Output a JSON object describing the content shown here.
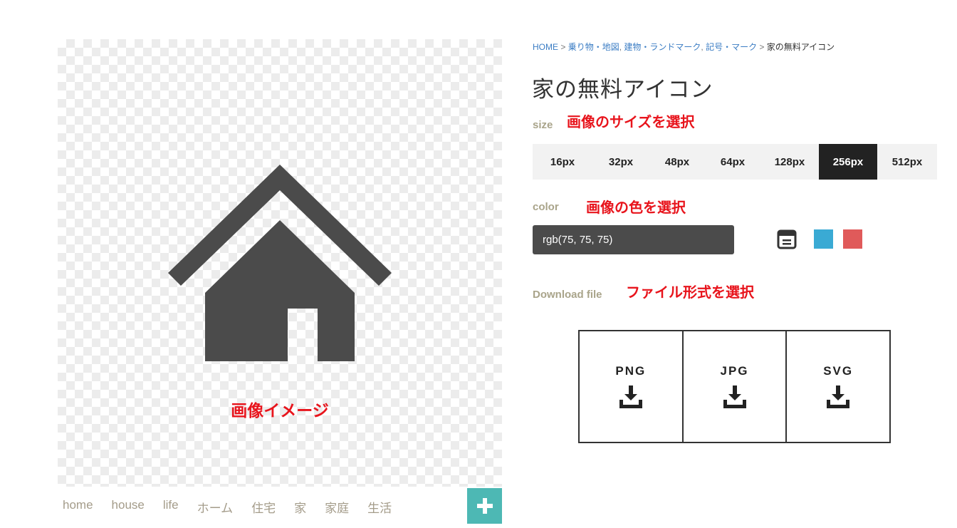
{
  "preview": {
    "caption": "画像イメージ",
    "icon_color": "#4b4b4b"
  },
  "tags": [
    "home",
    "house",
    "life",
    "ホーム",
    "住宅",
    "家",
    "家庭",
    "生活"
  ],
  "add_button": {
    "icon": "plus-icon",
    "color": "#4db8b4"
  },
  "breadcrumb": {
    "home": "HOME",
    "sep": ">",
    "cat1": "乗り物・地図",
    "cat2": "建物・ランドマーク",
    "cat3": "記号・マーク",
    "current": "家の無料アイコン"
  },
  "title": "家の無料アイコン",
  "size": {
    "label": "size",
    "annotation": "画像のサイズを選択",
    "options": [
      "16px",
      "32px",
      "48px",
      "64px",
      "128px",
      "256px",
      "512px"
    ],
    "selected": "256px"
  },
  "color": {
    "label": "color",
    "annotation": "画像の色を選択",
    "value": "rgb(75, 75, 75)",
    "swatches": [
      "#3aaad4",
      "#e05a5a"
    ]
  },
  "download": {
    "label": "Download file",
    "annotation": "ファイル形式を選択",
    "formats": [
      "PNG",
      "JPG",
      "SVG"
    ]
  },
  "colors": {
    "accent": "#e8141c",
    "active_size": "#222222"
  }
}
